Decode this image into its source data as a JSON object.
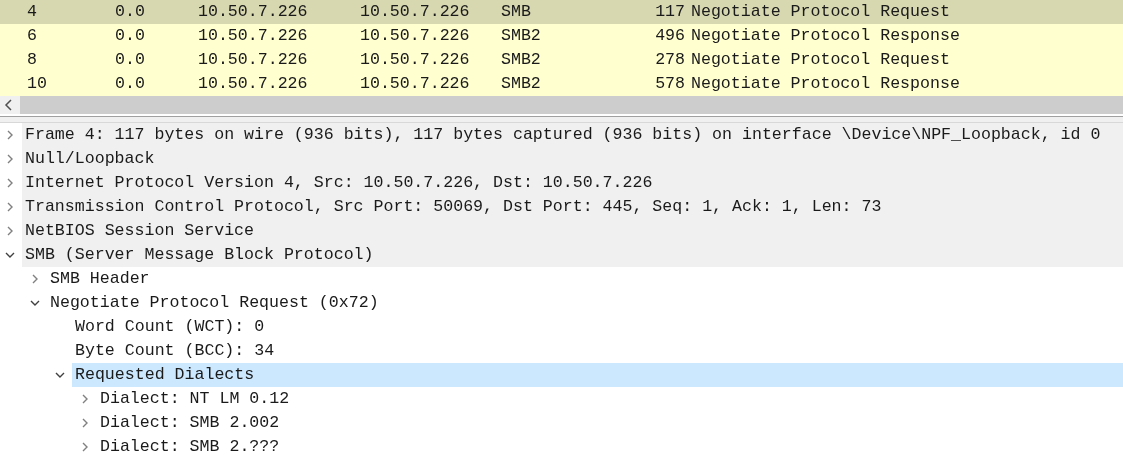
{
  "packet_list": {
    "rows": [
      {
        "no": "4",
        "time": "0.0",
        "source": "10.50.7.226",
        "destination": "10.50.7.226",
        "protocol": "SMB",
        "length": "117",
        "info": "Negotiate Protocol Request",
        "selected": true
      },
      {
        "no": "6",
        "time": "0.0",
        "source": "10.50.7.226",
        "destination": "10.50.7.226",
        "protocol": "SMB2",
        "length": "496",
        "info": "Negotiate Protocol Response",
        "selected": false
      },
      {
        "no": "8",
        "time": "0.0",
        "source": "10.50.7.226",
        "destination": "10.50.7.226",
        "protocol": "SMB2",
        "length": "278",
        "info": "Negotiate Protocol Request",
        "selected": false
      },
      {
        "no": "10",
        "time": "0.0",
        "source": "10.50.7.226",
        "destination": "10.50.7.226",
        "protocol": "SMB2",
        "length": "578",
        "info": "Negotiate Protocol Response",
        "selected": false
      }
    ]
  },
  "details": {
    "items": [
      {
        "label": "Frame 4: 117 bytes on wire (936 bits), 117 bytes captured (936 bits) on interface \\Device\\NPF_Loopback, id 0",
        "expanded": false,
        "selected": false
      },
      {
        "label": "Null/Loopback",
        "expanded": false,
        "selected": false
      },
      {
        "label": "Internet Protocol Version 4, Src: 10.50.7.226, Dst: 10.50.7.226",
        "expanded": false,
        "selected": false
      },
      {
        "label": "Transmission Control Protocol, Src Port: 50069, Dst Port: 445, Seq: 1, Ack: 1, Len: 73",
        "expanded": false,
        "selected": false
      },
      {
        "label": "NetBIOS Session Service",
        "expanded": false,
        "selected": false
      },
      {
        "label": "SMB (Server Message Block Protocol)",
        "expanded": true,
        "selected": false,
        "children": [
          {
            "label": "SMB Header",
            "expanded": false,
            "selected": false
          },
          {
            "label": "Negotiate Protocol Request (0x72)",
            "expanded": true,
            "selected": false,
            "children": [
              {
                "label": "Word Count (WCT): 0",
                "selected": false
              },
              {
                "label": "Byte Count (BCC): 34",
                "selected": false
              },
              {
                "label": "Requested Dialects",
                "expanded": true,
                "selected": true,
                "children": [
                  {
                    "label": "Dialect: NT LM 0.12",
                    "expanded": false,
                    "selected": false
                  },
                  {
                    "label": "Dialect: SMB 2.002",
                    "expanded": false,
                    "selected": false
                  },
                  {
                    "label": "Dialect: SMB 2.???",
                    "expanded": false,
                    "selected": false
                  }
                ]
              }
            ]
          }
        ]
      }
    ]
  }
}
